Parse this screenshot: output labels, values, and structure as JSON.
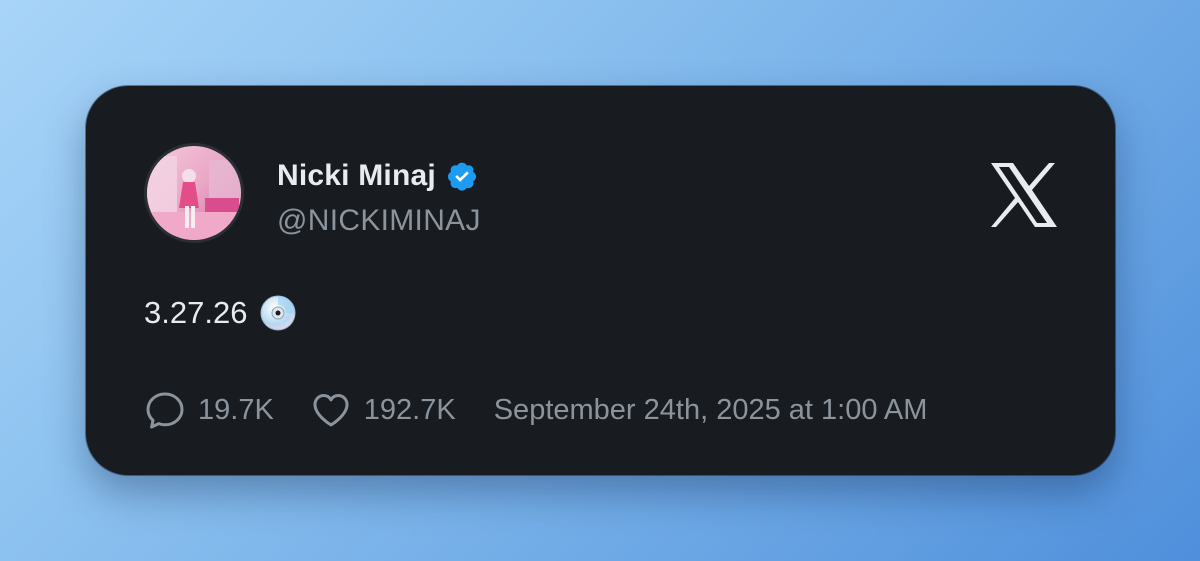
{
  "tweet": {
    "display_name": "Nicki Minaj",
    "handle": "@NICKIMINAJ",
    "verified": true,
    "text": "3.27.26",
    "text_emoji": "optical-disc-icon",
    "replies": "19.7K",
    "likes": "192.7K",
    "timestamp": "September 24th, 2025 at 1:00 AM"
  },
  "icons": {
    "platform": "x-logo-icon",
    "reply": "speech-bubble-icon",
    "like": "heart-icon",
    "verified": "verified-badge-icon"
  },
  "colors": {
    "card_background": "#181c21",
    "primary_text": "#e9ebee",
    "secondary_text": "#8b939c",
    "verified_blue": "#1d9bf0"
  }
}
